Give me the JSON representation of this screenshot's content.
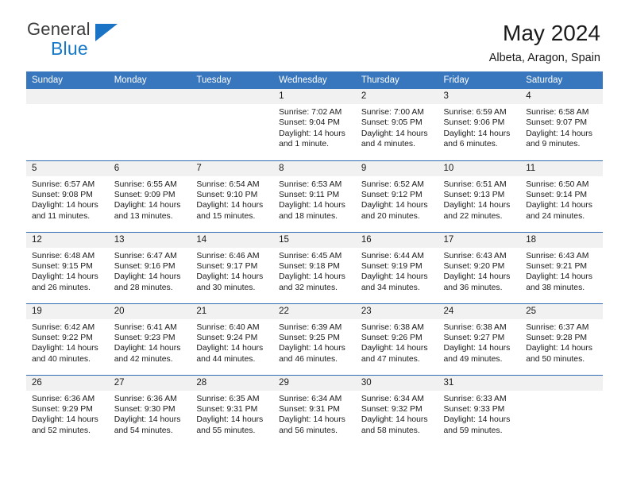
{
  "brand": {
    "name_top": "General",
    "name_bottom": "Blue",
    "accent_color": "#1778c8",
    "triangle_color": "#1a73c4"
  },
  "header": {
    "title": "May 2024",
    "subtitle": "Albeta, Aragon, Spain"
  },
  "calendar": {
    "header_bg": "#3876bd",
    "header_text_color": "#ffffff",
    "row_divider_color": "#2f6cb4",
    "daynum_bg": "#f1f1f1",
    "weekdays": [
      "Sunday",
      "Monday",
      "Tuesday",
      "Wednesday",
      "Thursday",
      "Friday",
      "Saturday"
    ],
    "weeks": [
      [
        {
          "day": "",
          "sunrise": "",
          "sunset": "",
          "daylight": ""
        },
        {
          "day": "",
          "sunrise": "",
          "sunset": "",
          "daylight": ""
        },
        {
          "day": "",
          "sunrise": "",
          "sunset": "",
          "daylight": ""
        },
        {
          "day": "1",
          "sunrise": "Sunrise: 7:02 AM",
          "sunset": "Sunset: 9:04 PM",
          "daylight": "Daylight: 14 hours and 1 minute."
        },
        {
          "day": "2",
          "sunrise": "Sunrise: 7:00 AM",
          "sunset": "Sunset: 9:05 PM",
          "daylight": "Daylight: 14 hours and 4 minutes."
        },
        {
          "day": "3",
          "sunrise": "Sunrise: 6:59 AM",
          "sunset": "Sunset: 9:06 PM",
          "daylight": "Daylight: 14 hours and 6 minutes."
        },
        {
          "day": "4",
          "sunrise": "Sunrise: 6:58 AM",
          "sunset": "Sunset: 9:07 PM",
          "daylight": "Daylight: 14 hours and 9 minutes."
        }
      ],
      [
        {
          "day": "5",
          "sunrise": "Sunrise: 6:57 AM",
          "sunset": "Sunset: 9:08 PM",
          "daylight": "Daylight: 14 hours and 11 minutes."
        },
        {
          "day": "6",
          "sunrise": "Sunrise: 6:55 AM",
          "sunset": "Sunset: 9:09 PM",
          "daylight": "Daylight: 14 hours and 13 minutes."
        },
        {
          "day": "7",
          "sunrise": "Sunrise: 6:54 AM",
          "sunset": "Sunset: 9:10 PM",
          "daylight": "Daylight: 14 hours and 15 minutes."
        },
        {
          "day": "8",
          "sunrise": "Sunrise: 6:53 AM",
          "sunset": "Sunset: 9:11 PM",
          "daylight": "Daylight: 14 hours and 18 minutes."
        },
        {
          "day": "9",
          "sunrise": "Sunrise: 6:52 AM",
          "sunset": "Sunset: 9:12 PM",
          "daylight": "Daylight: 14 hours and 20 minutes."
        },
        {
          "day": "10",
          "sunrise": "Sunrise: 6:51 AM",
          "sunset": "Sunset: 9:13 PM",
          "daylight": "Daylight: 14 hours and 22 minutes."
        },
        {
          "day": "11",
          "sunrise": "Sunrise: 6:50 AM",
          "sunset": "Sunset: 9:14 PM",
          "daylight": "Daylight: 14 hours and 24 minutes."
        }
      ],
      [
        {
          "day": "12",
          "sunrise": "Sunrise: 6:48 AM",
          "sunset": "Sunset: 9:15 PM",
          "daylight": "Daylight: 14 hours and 26 minutes."
        },
        {
          "day": "13",
          "sunrise": "Sunrise: 6:47 AM",
          "sunset": "Sunset: 9:16 PM",
          "daylight": "Daylight: 14 hours and 28 minutes."
        },
        {
          "day": "14",
          "sunrise": "Sunrise: 6:46 AM",
          "sunset": "Sunset: 9:17 PM",
          "daylight": "Daylight: 14 hours and 30 minutes."
        },
        {
          "day": "15",
          "sunrise": "Sunrise: 6:45 AM",
          "sunset": "Sunset: 9:18 PM",
          "daylight": "Daylight: 14 hours and 32 minutes."
        },
        {
          "day": "16",
          "sunrise": "Sunrise: 6:44 AM",
          "sunset": "Sunset: 9:19 PM",
          "daylight": "Daylight: 14 hours and 34 minutes."
        },
        {
          "day": "17",
          "sunrise": "Sunrise: 6:43 AM",
          "sunset": "Sunset: 9:20 PM",
          "daylight": "Daylight: 14 hours and 36 minutes."
        },
        {
          "day": "18",
          "sunrise": "Sunrise: 6:43 AM",
          "sunset": "Sunset: 9:21 PM",
          "daylight": "Daylight: 14 hours and 38 minutes."
        }
      ],
      [
        {
          "day": "19",
          "sunrise": "Sunrise: 6:42 AM",
          "sunset": "Sunset: 9:22 PM",
          "daylight": "Daylight: 14 hours and 40 minutes."
        },
        {
          "day": "20",
          "sunrise": "Sunrise: 6:41 AM",
          "sunset": "Sunset: 9:23 PM",
          "daylight": "Daylight: 14 hours and 42 minutes."
        },
        {
          "day": "21",
          "sunrise": "Sunrise: 6:40 AM",
          "sunset": "Sunset: 9:24 PM",
          "daylight": "Daylight: 14 hours and 44 minutes."
        },
        {
          "day": "22",
          "sunrise": "Sunrise: 6:39 AM",
          "sunset": "Sunset: 9:25 PM",
          "daylight": "Daylight: 14 hours and 46 minutes."
        },
        {
          "day": "23",
          "sunrise": "Sunrise: 6:38 AM",
          "sunset": "Sunset: 9:26 PM",
          "daylight": "Daylight: 14 hours and 47 minutes."
        },
        {
          "day": "24",
          "sunrise": "Sunrise: 6:38 AM",
          "sunset": "Sunset: 9:27 PM",
          "daylight": "Daylight: 14 hours and 49 minutes."
        },
        {
          "day": "25",
          "sunrise": "Sunrise: 6:37 AM",
          "sunset": "Sunset: 9:28 PM",
          "daylight": "Daylight: 14 hours and 50 minutes."
        }
      ],
      [
        {
          "day": "26",
          "sunrise": "Sunrise: 6:36 AM",
          "sunset": "Sunset: 9:29 PM",
          "daylight": "Daylight: 14 hours and 52 minutes."
        },
        {
          "day": "27",
          "sunrise": "Sunrise: 6:36 AM",
          "sunset": "Sunset: 9:30 PM",
          "daylight": "Daylight: 14 hours and 54 minutes."
        },
        {
          "day": "28",
          "sunrise": "Sunrise: 6:35 AM",
          "sunset": "Sunset: 9:31 PM",
          "daylight": "Daylight: 14 hours and 55 minutes."
        },
        {
          "day": "29",
          "sunrise": "Sunrise: 6:34 AM",
          "sunset": "Sunset: 9:31 PM",
          "daylight": "Daylight: 14 hours and 56 minutes."
        },
        {
          "day": "30",
          "sunrise": "Sunrise: 6:34 AM",
          "sunset": "Sunset: 9:32 PM",
          "daylight": "Daylight: 14 hours and 58 minutes."
        },
        {
          "day": "31",
          "sunrise": "Sunrise: 6:33 AM",
          "sunset": "Sunset: 9:33 PM",
          "daylight": "Daylight: 14 hours and 59 minutes."
        },
        {
          "day": "",
          "sunrise": "",
          "sunset": "",
          "daylight": ""
        }
      ]
    ]
  }
}
